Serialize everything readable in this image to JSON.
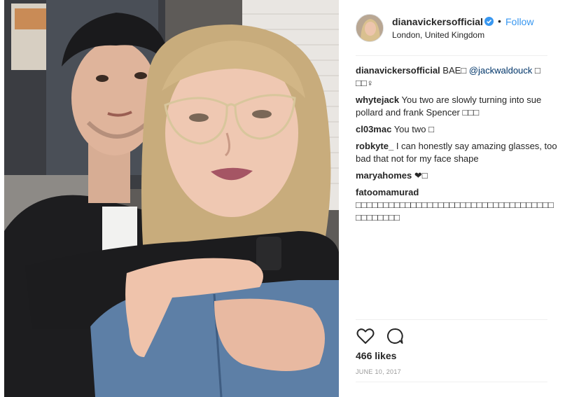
{
  "post": {
    "username": "dianavickersofficial",
    "follow_label": "Follow",
    "dot": "•",
    "location": "London, United Kingdom",
    "likes": "466 likes",
    "date": "JUNE 10, 2017"
  },
  "comments": [
    {
      "user": "dianavickersofficial",
      "text": " BAE□ ",
      "mention": "@jackwaldouck",
      "tail": " □ □□♀"
    },
    {
      "user": "whytejack",
      "text": " You two are slowly turning into sue pollard and frank Spencer □□□",
      "mention": "",
      "tail": ""
    },
    {
      "user": "cl03mac",
      "text": " You two □",
      "mention": "",
      "tail": ""
    },
    {
      "user": "robkyte_",
      "text": " I can honestly say amazing glasses, too bad that not for my face shape",
      "mention": "",
      "tail": ""
    },
    {
      "user": "maryahomes",
      "text": " ❤□",
      "mention": "",
      "tail": ""
    },
    {
      "user": "fatoomamurad",
      "text": " □□□□□□□□□□□□□□□□□□□□□□□□□□□□□□□□□□□□□□□□□□□□",
      "mention": "",
      "tail": ""
    }
  ],
  "icons": {
    "like": "heart-icon",
    "comment": "comment-bubble-icon",
    "verified": "verified-badge-icon"
  },
  "colors": {
    "follow": "#3897f0",
    "verified": "#3897f0",
    "date": "#999999"
  }
}
